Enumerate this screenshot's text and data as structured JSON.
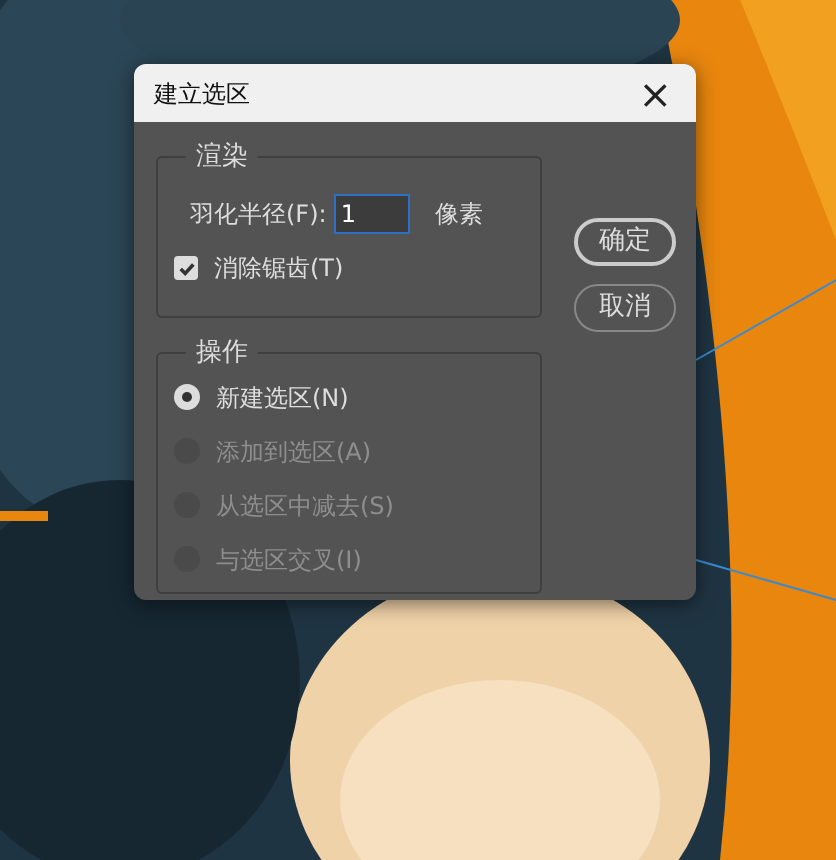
{
  "dialog": {
    "title": "建立选区",
    "close": "×",
    "rendering": {
      "legend": "渲染",
      "feather_label": "羽化半径(F):",
      "feather_value": "1",
      "feather_unit": "像素",
      "antialias": {
        "label": "消除锯齿(T)",
        "checked": true
      }
    },
    "operation": {
      "legend": "操作",
      "options": [
        {
          "label": "新建选区(N)",
          "selected": true,
          "disabled": false
        },
        {
          "label": "添加到选区(A)",
          "selected": false,
          "disabled": true
        },
        {
          "label": "从选区中减去(S)",
          "selected": false,
          "disabled": true
        },
        {
          "label": "与选区交叉(I)",
          "selected": false,
          "disabled": true
        }
      ]
    },
    "buttons": [
      {
        "label": "确定",
        "kind": "default"
      },
      {
        "label": "取消",
        "kind": "normal"
      }
    ]
  }
}
